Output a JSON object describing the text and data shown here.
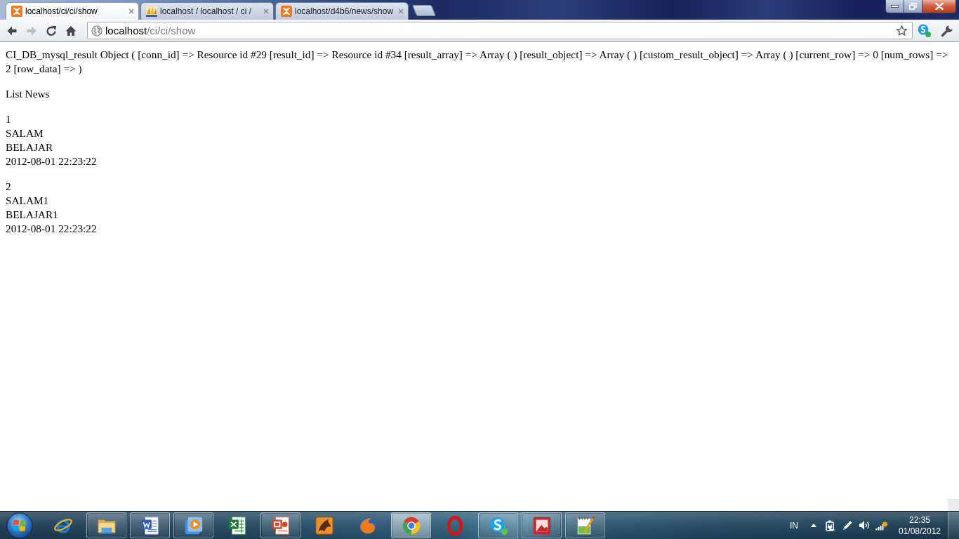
{
  "browser": {
    "tabs": [
      {
        "kind": "tile",
        "title": "localhost/ci/ci/show",
        "selected": true
      },
      {
        "kind": "sail",
        "title": "localhost / localhost / ci /",
        "selected": false
      },
      {
        "kind": "tile",
        "title": "localhost/d4b6/news/show",
        "selected": false
      }
    ],
    "navigation": [
      {
        "kind": "back",
        "disabled": false
      },
      {
        "kind": "forward",
        "disabled": true
      },
      {
        "kind": "reload",
        "disabled": false
      },
      {
        "kind": "home",
        "disabled": false
      }
    ],
    "address": {
      "host": "localhost",
      "path": "/ci/ci/show"
    }
  },
  "page": {
    "dump": "CI_DB_mysql_result Object ( [conn_id] => Resource id #29 [result_id] => Resource id #34 [result_array] => Array ( ) [result_object] => Array ( ) [custom_result_object] => Array ( ) [current_row] => 0 [num_rows] => 2 [row_data] => )",
    "heading": "List News",
    "news": [
      {
        "id": "1",
        "title": "SALAM",
        "body": "BELAJAR",
        "date": "2012-08-01 22:23:22"
      },
      {
        "id": "2",
        "title": "SALAM1",
        "body": "BELAJAR1",
        "date": "2012-08-01 22:23:22"
      }
    ]
  },
  "taskbar": {
    "apps": [
      {
        "kind": "e-ring",
        "open": false,
        "selected": false
      },
      {
        "kind": "folder",
        "open": true,
        "selected": false
      },
      {
        "kind": "document",
        "open": true,
        "selected": false
      },
      {
        "kind": "player",
        "open": true,
        "selected": false
      },
      {
        "kind": "spreadsheet",
        "open": false,
        "selected": false
      },
      {
        "kind": "presentation",
        "open": true,
        "selected": false
      },
      {
        "kind": "dragon",
        "open": false,
        "selected": false
      },
      {
        "kind": "fox",
        "open": false,
        "selected": false
      },
      {
        "kind": "segmented",
        "open": true,
        "selected": true
      },
      {
        "kind": "ring",
        "open": false,
        "selected": false
      },
      {
        "kind": "chat",
        "open": true,
        "selected": false
      },
      {
        "kind": "picture",
        "open": true,
        "selected": false
      },
      {
        "kind": "notepad",
        "open": true,
        "selected": false
      }
    ],
    "language": "IN",
    "clock": {
      "time": "22:35",
      "date": "01/08/2012"
    }
  }
}
